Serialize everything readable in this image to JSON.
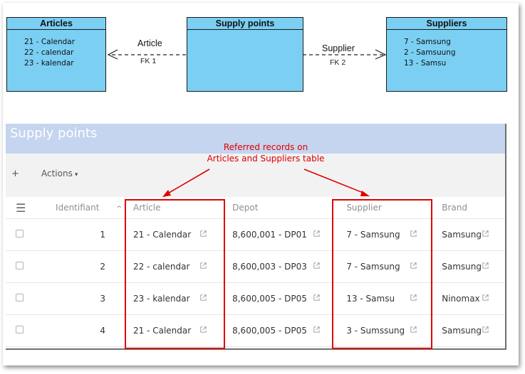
{
  "diagram": {
    "entities": {
      "articles": {
        "title": "Articles",
        "rows": [
          "21 - Calendar",
          "22 - calendar",
          "23 - kalendar"
        ]
      },
      "supply_points": {
        "title": "Supply points",
        "rows": []
      },
      "suppliers": {
        "title": "Suppliers",
        "rows": [
          "7 - Samsung",
          "2 - Samsuung",
          "13 - Samsu"
        ]
      }
    },
    "relations": [
      {
        "label": "Article",
        "fk": "FK 1"
      },
      {
        "label": "Supplier",
        "fk": "FK 2"
      }
    ],
    "colors": {
      "entity_fill": "#7acff3",
      "entity_border": "#1a1a1a"
    }
  },
  "annotation": {
    "line1": "Referred records on",
    "line2": "Articles and Suppliers table",
    "color": "#e00000"
  },
  "app": {
    "title": "Supply points",
    "toolbar": {
      "add_icon": "+",
      "actions_label": "Actions",
      "actions_caret": "▾"
    },
    "table": {
      "columns": {
        "menu_icon": "☰",
        "identifiant": "Identifiant",
        "sort_icon": "^",
        "article": "Article",
        "depot": "Depot",
        "supplier": "Supplier",
        "brand": "Brand"
      },
      "rows": [
        {
          "id": "1",
          "article": "21 - Calendar",
          "depot": "8,600,001 - DP01",
          "supplier": "7 - Samsung",
          "brand": "Samsung"
        },
        {
          "id": "2",
          "article": "22 - calendar",
          "depot": "8,600,003 - DP03",
          "supplier": "7 - Samsung",
          "brand": "Samsung"
        },
        {
          "id": "3",
          "article": "23 - kalendar",
          "depot": "8,600,005 - DP05",
          "supplier": "13 - Samsu",
          "brand": "Ninomax"
        },
        {
          "id": "4",
          "article": "21 - Calendar",
          "depot": "8,600,005 - DP05",
          "supplier": "3 - Sumssung",
          "brand": "Samsung"
        }
      ]
    },
    "colors": {
      "header_bg": "#c5d4ef",
      "toolbar_bg": "#f2f2f2"
    }
  }
}
